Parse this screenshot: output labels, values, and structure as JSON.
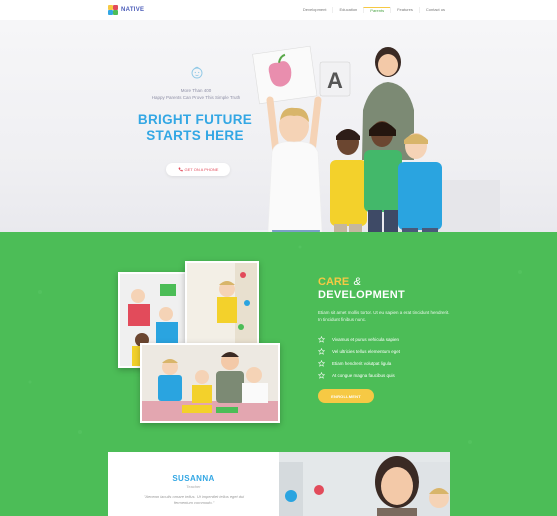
{
  "nav": {
    "logo_text": "NATIVE",
    "items": [
      {
        "label": "Development",
        "active": false
      },
      {
        "label": "Education",
        "active": false
      },
      {
        "label": "Parents",
        "active": true
      },
      {
        "label": "Features",
        "active": false
      },
      {
        "label": "Contact us",
        "active": false
      }
    ]
  },
  "hero": {
    "tagline_line1": "More Than 400",
    "tagline_line2": "Happy Parents Can Prove This Simple Truth",
    "headline_line1": "BRIGHT FUTURE",
    "headline_line2": "STARTS HERE",
    "phone_button_label": "GET ON A PHONE",
    "icon": "baby-face-icon"
  },
  "care": {
    "title_word1": "CARE",
    "title_amp": "&",
    "title_word2": "DEVELOPMENT",
    "description": "Etiam sit amet mollis tortor. Ut eu sapien a erat tincidunt hendrerit. In tincidunt finibus nunc.",
    "features": [
      "Vivamus et purus vehicula sapien",
      "Vel ultricies tellus elementum eget",
      "Etiam hendrerit volutpat ligula",
      "At congue magna faucibus quis"
    ],
    "enroll_label": "ENROLLMENT",
    "feature_icon": "star-outline-icon"
  },
  "testimonial": {
    "name": "SUSANNA",
    "role": "Teacher",
    "quote": "\"Aenean iaculis ornare tellus. Ut imperdiet tellus eget dui fermentum commodo.\""
  },
  "colors": {
    "green": "#4cbd57",
    "blue": "#33a7e4",
    "yellow": "#f6c944",
    "red": "#e24b5b"
  }
}
